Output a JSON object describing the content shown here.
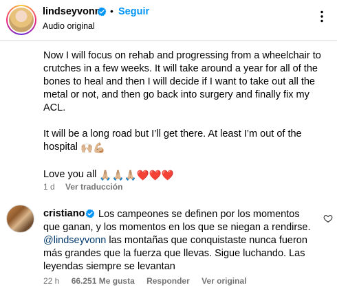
{
  "header": {
    "username": "lindseyvonn",
    "separator": "•",
    "follow_label": "Seguir",
    "subtitle": "Audio original"
  },
  "post": {
    "paragraph1": "Now I will focus on rehab and progressing from a wheelchair to crutches in a few weeks. It will take around a year for all of the bones to heal and then I will decide if I want to take out all the metal or not, and then go back into surgery and finally fix my ACL.",
    "paragraph2": "It will be a long road but I’ll get there. At least I’m out of the hospital",
    "paragraph2_emojis": "🙌🏼💪🏼",
    "paragraph3": "Love you all",
    "paragraph3_emojis": "🙏🏼🙏🏼🙏🏼❤️❤️❤️",
    "time": "1 d",
    "translate_label": "Ver traducción"
  },
  "comment": {
    "username": "cristiano",
    "text_before_mention": "Los campeones se definen por los momentos que ganan, y los momentos en los que se niegan a rendirse.",
    "mention": "@lindseyvonn",
    "text_after_mention": " las montañas que conquistaste nunca fueron más grandes que la fuerza que llevas. Sigue luchando. Las leyendas siempre se levantan",
    "time": "22 h",
    "likes": "66.251 Me gusta",
    "reply_label": "Responder",
    "original_label": "Ver original"
  },
  "colors": {
    "accent": "#0095f6",
    "mention": "#00376b",
    "verified": "#0095f6",
    "muted": "#737373"
  },
  "icons": [
    "verified-badge-icon",
    "more-options-icon",
    "heart-icon"
  ]
}
